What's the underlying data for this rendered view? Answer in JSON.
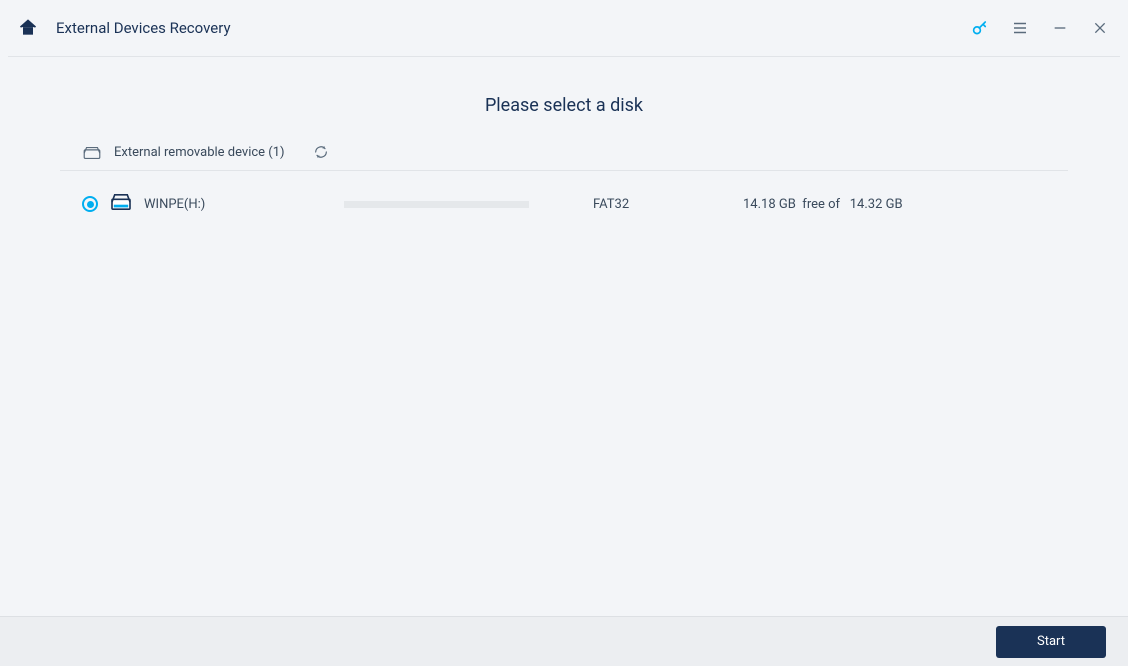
{
  "header": {
    "title": "External Devices Recovery"
  },
  "main": {
    "instruction": "Please select a disk",
    "section_label": "External removable device (1)"
  },
  "devices": [
    {
      "name": "WINPE(H:)",
      "filesystem": "FAT32",
      "free": "14.18 GB",
      "free_of_label": "free of",
      "total": "14.32 GB"
    }
  ],
  "footer": {
    "start_label": "Start"
  },
  "colors": {
    "accent": "#00aef0",
    "primary_dark": "#1a3256"
  }
}
